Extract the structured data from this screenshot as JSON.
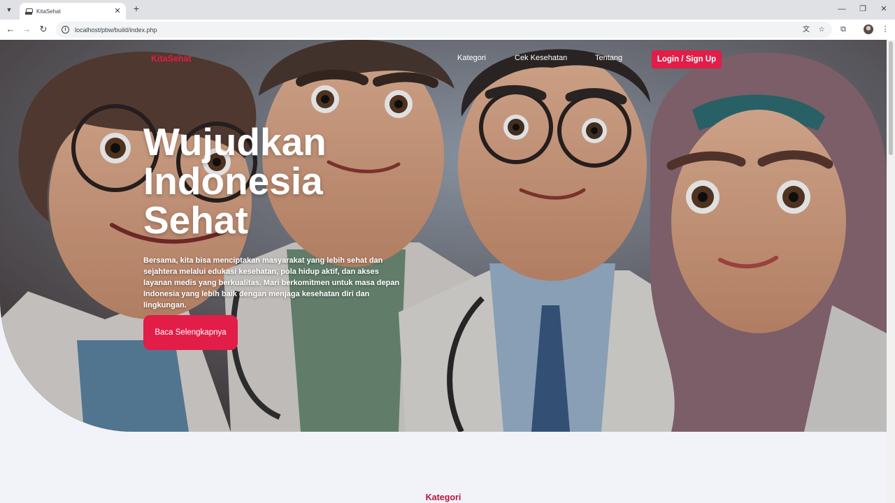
{
  "browser": {
    "tab_title": "KitaSehat",
    "url": "localhost/pbw/build/index.php"
  },
  "navbar": {
    "brand": "KitaSehat",
    "links": [
      "Kategori",
      "Cek Kesehatan",
      "Tentang"
    ],
    "login_label": "Login / Sign Up"
  },
  "hero": {
    "headline_lines": [
      "Wujudkan",
      "Indonesia",
      "Sehat"
    ],
    "description": "Bersama, kita bisa menciptakan masyarakat yang lebih sehat dan sejahtera melalui edukasi kesehatan, pola hidup aktif, dan akses layanan medis yang berkualitas. Mari berkomitmen untuk masa depan Indonesia yang lebih baik dengan menjaga kesehatan diri dan lingkungan.",
    "cta_label": "Baca Selengkapnya"
  },
  "sections": {
    "category_title": "Kategori"
  },
  "colors": {
    "accent": "#e11d48",
    "section_title": "#be123c",
    "page_bg": "#f1f3f9"
  }
}
